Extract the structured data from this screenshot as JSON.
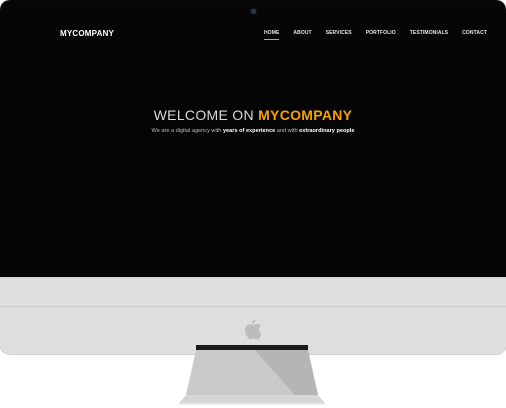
{
  "site": {
    "logo": "MYCOMPANY",
    "nav": [
      "HOME",
      "ABOUT",
      "SERVICES",
      "PORTFOLIO",
      "TESTIMONIALS",
      "CONTACT"
    ],
    "active_nav": "HOME"
  },
  "hero": {
    "title_prefix": "WELCOME ON ",
    "title_accent": "MYCOMPANY",
    "sub_1": "We are a digital agency with ",
    "sub_2": "years of experience",
    "sub_3": " and with ",
    "sub_4": "extraordinary people"
  },
  "colors": {
    "accent": "#f4a300",
    "screen": "#050505",
    "chin": "#dedede"
  },
  "icons": {
    "device_logo": "apple-icon",
    "camera": "camera-icon"
  }
}
